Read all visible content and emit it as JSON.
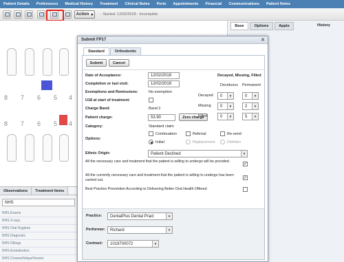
{
  "topnav": [
    "Patient Details",
    "Preferences",
    "Medical History",
    "Treatment",
    "Clinical Notes",
    "Perio",
    "Appointments",
    "Financial",
    "Communications",
    "Patient Notes"
  ],
  "toolbar": {
    "action_label": "Action",
    "status": "- Started: 12/02/2018 - Incomplete"
  },
  "right_panel": {
    "tabs": [
      "Base",
      "Options",
      "Appts"
    ],
    "history_label": "History"
  },
  "chart": {
    "numbers_upper": [
      "8",
      "7",
      "6",
      "5",
      "4"
    ],
    "numbers_lower": [
      "8",
      "7",
      "6",
      "5",
      "4"
    ]
  },
  "observations": {
    "tabs": [
      "Observations",
      "Treatment Items"
    ],
    "select_value": "NHS",
    "items": [
      "NHS Exams",
      "NHS X-rays",
      "NHS Oral Hygiene",
      "NHS Diagnosis",
      "NHS Fillings",
      "NHS Endodontics",
      "NHS Crowns/Inlays/Veneer"
    ]
  },
  "modal": {
    "title": "Submit FP17",
    "tabs": [
      "Standard",
      "Orthodontic"
    ],
    "submit_label": "Submit",
    "cancel_label": "Cancel",
    "date_of_acceptance_label": "Date of Acceptance:",
    "date_of_acceptance": "12/02/2018",
    "completion_label": "Completion or last visit:",
    "completion_date": "12/02/2018",
    "exemptions_label": "Exemptions and Remissions:",
    "exemptions_value": "No exemption",
    "u18_label": "U18 at start of treatment:",
    "charge_band_label": "Charge Band:",
    "charge_band_value": "Band 2",
    "patient_charge_label": "Patient charge:",
    "patient_charge_value": "53.90",
    "zero_charge_label": "Zero charge",
    "category_label": "Category:",
    "category_value": "Standard claim",
    "options_label": "Options:",
    "option_continuation": "Continuation",
    "option_referral": "Referral",
    "option_resend": "Re-send",
    "option_initial": "Initial",
    "option_replacement": "Replacement",
    "option_deletion": "Deletion",
    "ethnic_label": "Ethnic Origin:",
    "ethnic_value": "Patient Declined",
    "statement_1": "All the necessary care and treatment that the patient is willing to undergo will be provided.",
    "statement_2": "All the currently necessary care and treatment that the patient is willing to undergo has been carried out.",
    "statement_3": "Best Practice Prevention According to Delivering Better Oral Health Offered",
    "dmf_title": "Decayed, Missing, Filled",
    "deciduous_label": "Deciduous",
    "permanent_label": "Permanent",
    "decayed_label": "Decayed",
    "missing_label": "Missing",
    "filled_label": "Filled",
    "decayed_deciduous": "0",
    "decayed_permanent": "0",
    "missing_deciduous": "0",
    "missing_permanent": "2",
    "filled_deciduous": "0",
    "filled_permanent": "5",
    "practice_label": "Practice:",
    "practice_value": "DentalPlus Dental Pract",
    "performer_label": "Performer:",
    "performer_value": "Richard",
    "contract_label": "Contract:",
    "contract_value": "1019700072"
  }
}
